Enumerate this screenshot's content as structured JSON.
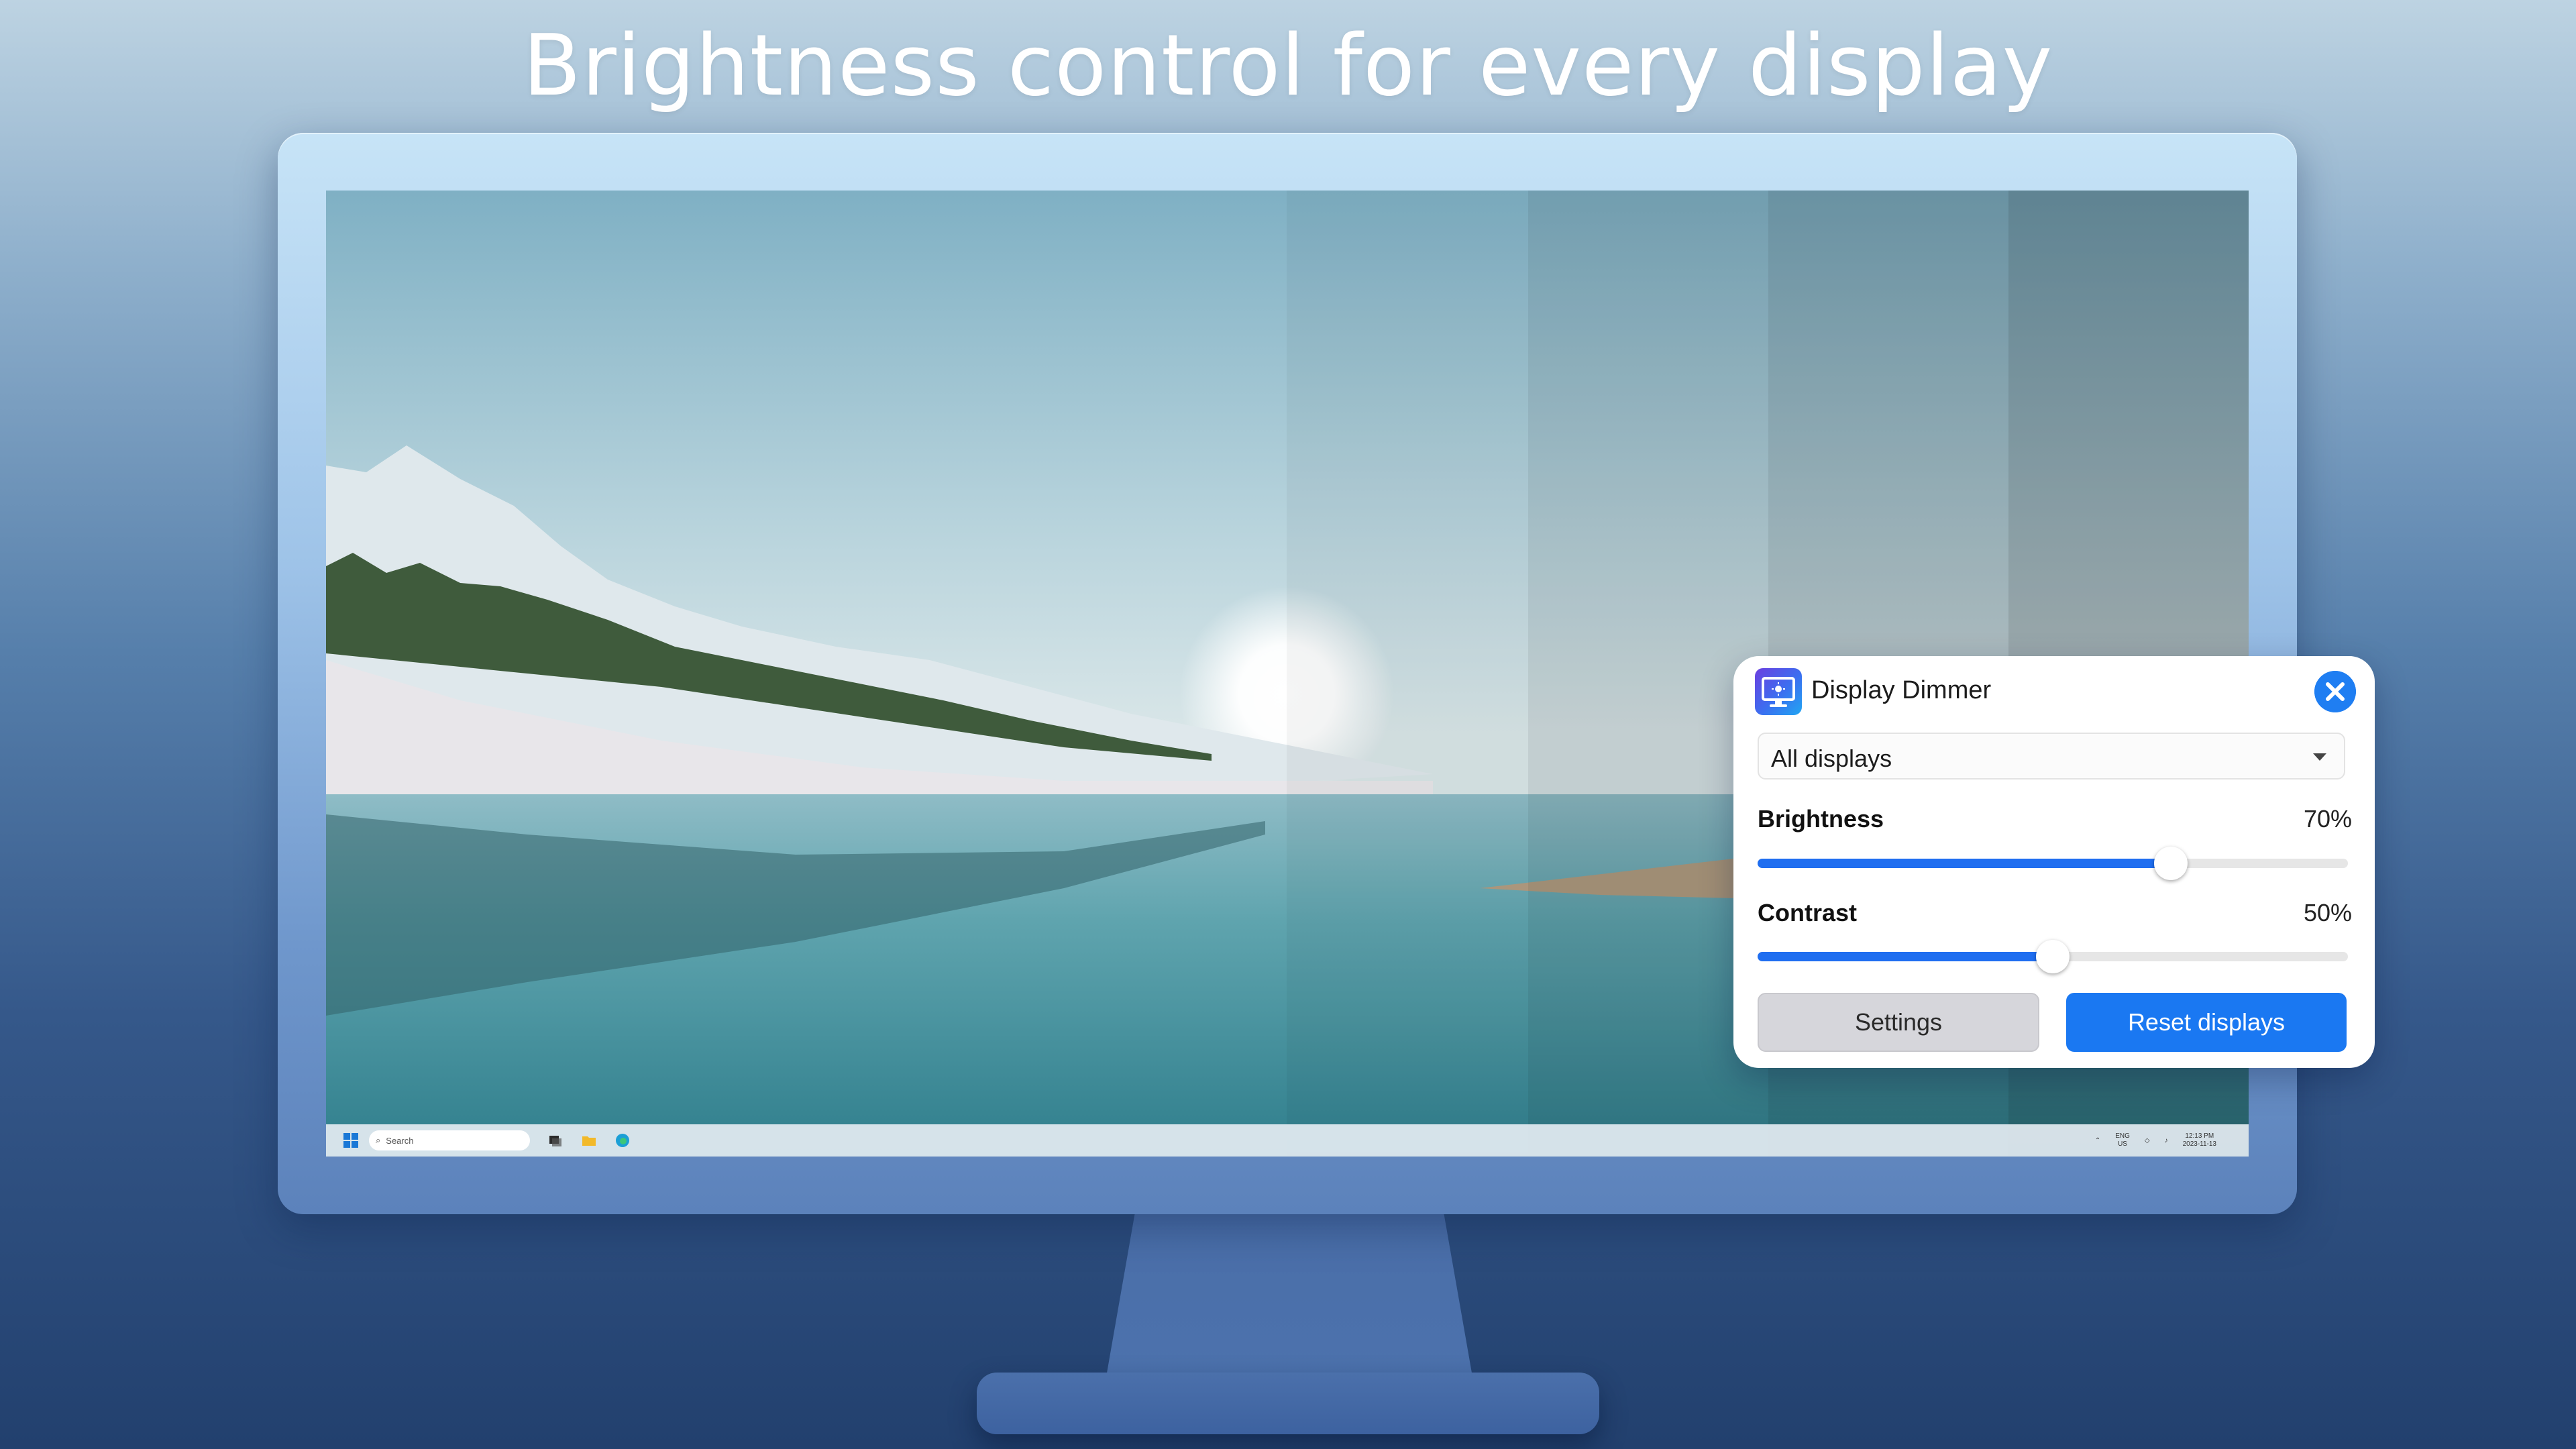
{
  "headline": "Brightness control for every display",
  "panel": {
    "title": "Display Dimmer",
    "display_select": {
      "selected": "All displays"
    },
    "brightness": {
      "label": "Brightness",
      "value_text": "70%",
      "value": 0.7
    },
    "contrast": {
      "label": "Contrast",
      "value_text": "50%",
      "value": 0.5
    },
    "settings_label": "Settings",
    "reset_label": "Reset displays"
  },
  "taskbar": {
    "search_placeholder": "Search",
    "lang_top": "ENG",
    "lang_bottom": "US",
    "clock_time": "12:13 PM",
    "clock_date": "2023-11-13"
  },
  "colors": {
    "accent": "#1a78f2",
    "slider_fill": "#1f6ef0",
    "panel_bg": "#ffffff"
  },
  "icons": {
    "close": "close-x-circle",
    "dropdown": "chevron-down",
    "app": "monitor-sun"
  }
}
